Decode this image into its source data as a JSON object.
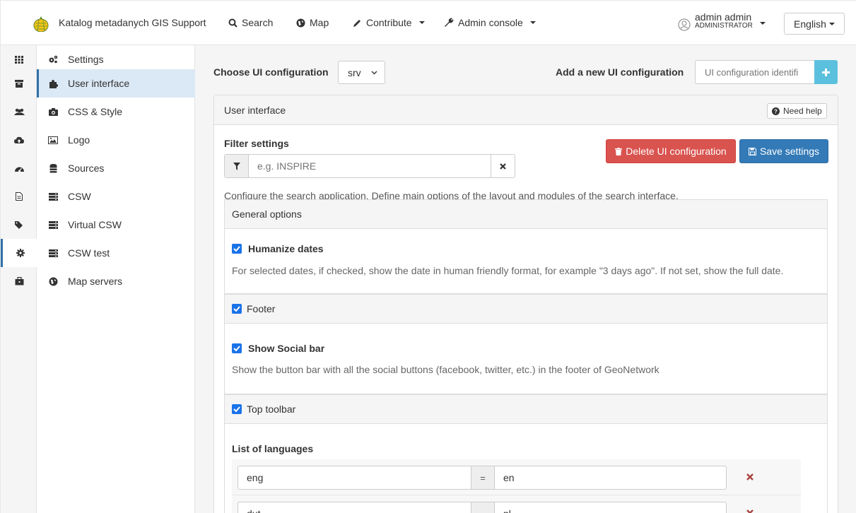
{
  "navbar": {
    "brand": "Katalog metadanych GIS Support",
    "search": "Search",
    "map": "Map",
    "contribute": "Contribute",
    "admin_console": "Admin console",
    "user_name": "admin admin",
    "user_role": "ADMINISTRATOR",
    "language": "English"
  },
  "icon_strip": [
    "grid-icon",
    "archive-icon",
    "users-icon",
    "cloud-upload-icon",
    "dashboard-icon",
    "file-icon",
    "tags-icon",
    "gear-icon",
    "toolbox-icon"
  ],
  "side_menu": {
    "items": [
      {
        "label": "Settings",
        "icon": "cogs-icon"
      },
      {
        "label": "User interface",
        "icon": "puzzle-icon"
      },
      {
        "label": "CSS & Style",
        "icon": "camera-icon"
      },
      {
        "label": "Logo",
        "icon": "picture-icon"
      },
      {
        "label": "Sources",
        "icon": "database-icon"
      },
      {
        "label": "CSW",
        "icon": "server-icon"
      },
      {
        "label": "Virtual CSW",
        "icon": "server-icon"
      },
      {
        "label": "CSW test",
        "icon": "server-icon"
      },
      {
        "label": "Map servers",
        "icon": "globe-icon"
      }
    ],
    "active": "User interface"
  },
  "main": {
    "choose_label": "Choose UI configuration",
    "selected_config": "srv",
    "add_label": "Add a new UI configuration",
    "add_placeholder": "UI configuration identifi",
    "panel_title": "User interface",
    "help": "Need help",
    "filter_label": "Filter settings",
    "filter_placeholder": "e.g. INSPIRE",
    "delete_button": "Delete UI configuration",
    "save_button": "Save settings",
    "intro": "Configure the search application. Define main options of the layout and modules of the search interface.",
    "general": {
      "title": "General options",
      "humanize_title": "Humanize dates",
      "humanize_desc": "For selected dates, if checked, show the date in human friendly format, for example \"3 days ago\". If not set, show the full date."
    },
    "footer": {
      "title": "Footer",
      "social_title": "Show Social bar",
      "social_desc": "Show the button bar with all the social buttons (facebook, twitter, etc.) in the footer of GeoNetwork"
    },
    "toolbar": {
      "title": "Top toolbar",
      "languages_label": "List of languages",
      "languages": [
        {
          "code": "eng",
          "value": "en"
        },
        {
          "code": "dut",
          "value": "nl"
        }
      ],
      "eq": "="
    }
  },
  "colors": {
    "primary": "#337ab7",
    "danger": "#d9534f",
    "info": "#5bc0de",
    "checkbox": "#1a73e8"
  }
}
